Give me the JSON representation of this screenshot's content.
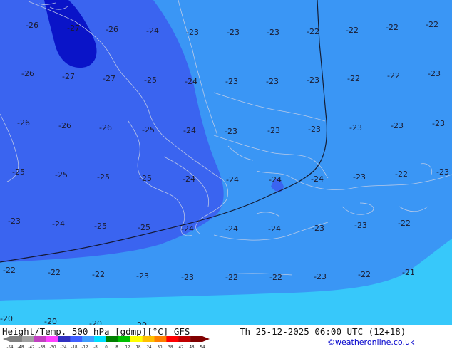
{
  "footer": {
    "product": "Height/Temp. 500 hPa [gdmp][°C] GFS",
    "datetime": "Th 25-12-2025 06:00 UTC (12+18)",
    "credit": "©weatheronline.co.uk"
  },
  "legend": {
    "ticks": [
      "-54",
      "-48",
      "-42",
      "-38",
      "-30",
      "-24",
      "-18",
      "-12",
      "-8",
      "0",
      "8",
      "12",
      "18",
      "24",
      "30",
      "38",
      "42",
      "48",
      "54"
    ],
    "colors": [
      "#808080",
      "#a0a0a0",
      "#c040c0",
      "#ff40ff",
      "#3030c0",
      "#4060ff",
      "#40a0ff",
      "#00e0ff",
      "#008000",
      "#00c000",
      "#ffff00",
      "#ffc000",
      "#ff8000",
      "#ff0000",
      "#c00000",
      "#800000"
    ]
  },
  "colors": {
    "band_minus27": "#0a14c8",
    "band_minus25": "#3a64f0",
    "band_minus23": "#3a96f5",
    "band_minus21": "#37c8fa"
  },
  "values": [
    {
      "t": "-26"
    },
    {
      "t": "-27"
    },
    {
      "t": "-26"
    },
    {
      "t": "-24"
    },
    {
      "t": "-23"
    },
    {
      "t": "-23"
    },
    {
      "t": "-23"
    },
    {
      "t": "-22"
    },
    {
      "t": "-22"
    },
    {
      "t": "-22"
    },
    {
      "t": "-22"
    },
    {
      "t": "-26"
    },
    {
      "t": "-27"
    },
    {
      "t": "-27"
    },
    {
      "t": "-25"
    },
    {
      "t": "-24"
    },
    {
      "t": "-23"
    },
    {
      "t": "-23"
    },
    {
      "t": "-23"
    },
    {
      "t": "-22"
    },
    {
      "t": "-22"
    },
    {
      "t": "-23"
    },
    {
      "t": "-26"
    },
    {
      "t": "-26"
    },
    {
      "t": "-26"
    },
    {
      "t": "-25"
    },
    {
      "t": "-24"
    },
    {
      "t": "-23"
    },
    {
      "t": "-23"
    },
    {
      "t": "-23"
    },
    {
      "t": "-23"
    },
    {
      "t": "-23"
    },
    {
      "t": "-23"
    },
    {
      "t": "-25"
    },
    {
      "t": "-25"
    },
    {
      "t": "-25"
    },
    {
      "t": "-25"
    },
    {
      "t": "-24"
    },
    {
      "t": "-24"
    },
    {
      "t": "-24"
    },
    {
      "t": "-24"
    },
    {
      "t": "-23"
    },
    {
      "t": "-22"
    },
    {
      "t": "-23"
    },
    {
      "t": "-23"
    },
    {
      "t": "-24"
    },
    {
      "t": "-25"
    },
    {
      "t": "-25"
    },
    {
      "t": "-24"
    },
    {
      "t": "-24"
    },
    {
      "t": "-24"
    },
    {
      "t": "-23"
    },
    {
      "t": "-23"
    },
    {
      "t": "-22"
    },
    {
      "t": "-22"
    },
    {
      "t": "-22"
    },
    {
      "t": "-22"
    },
    {
      "t": "-23"
    },
    {
      "t": "-23"
    },
    {
      "t": "-22"
    },
    {
      "t": "-22"
    },
    {
      "t": "-23"
    },
    {
      "t": "-22"
    },
    {
      "t": "-21"
    },
    {
      "t": "-20"
    },
    {
      "t": "-20"
    },
    {
      "t": "-20"
    },
    {
      "t": "-20"
    }
  ]
}
